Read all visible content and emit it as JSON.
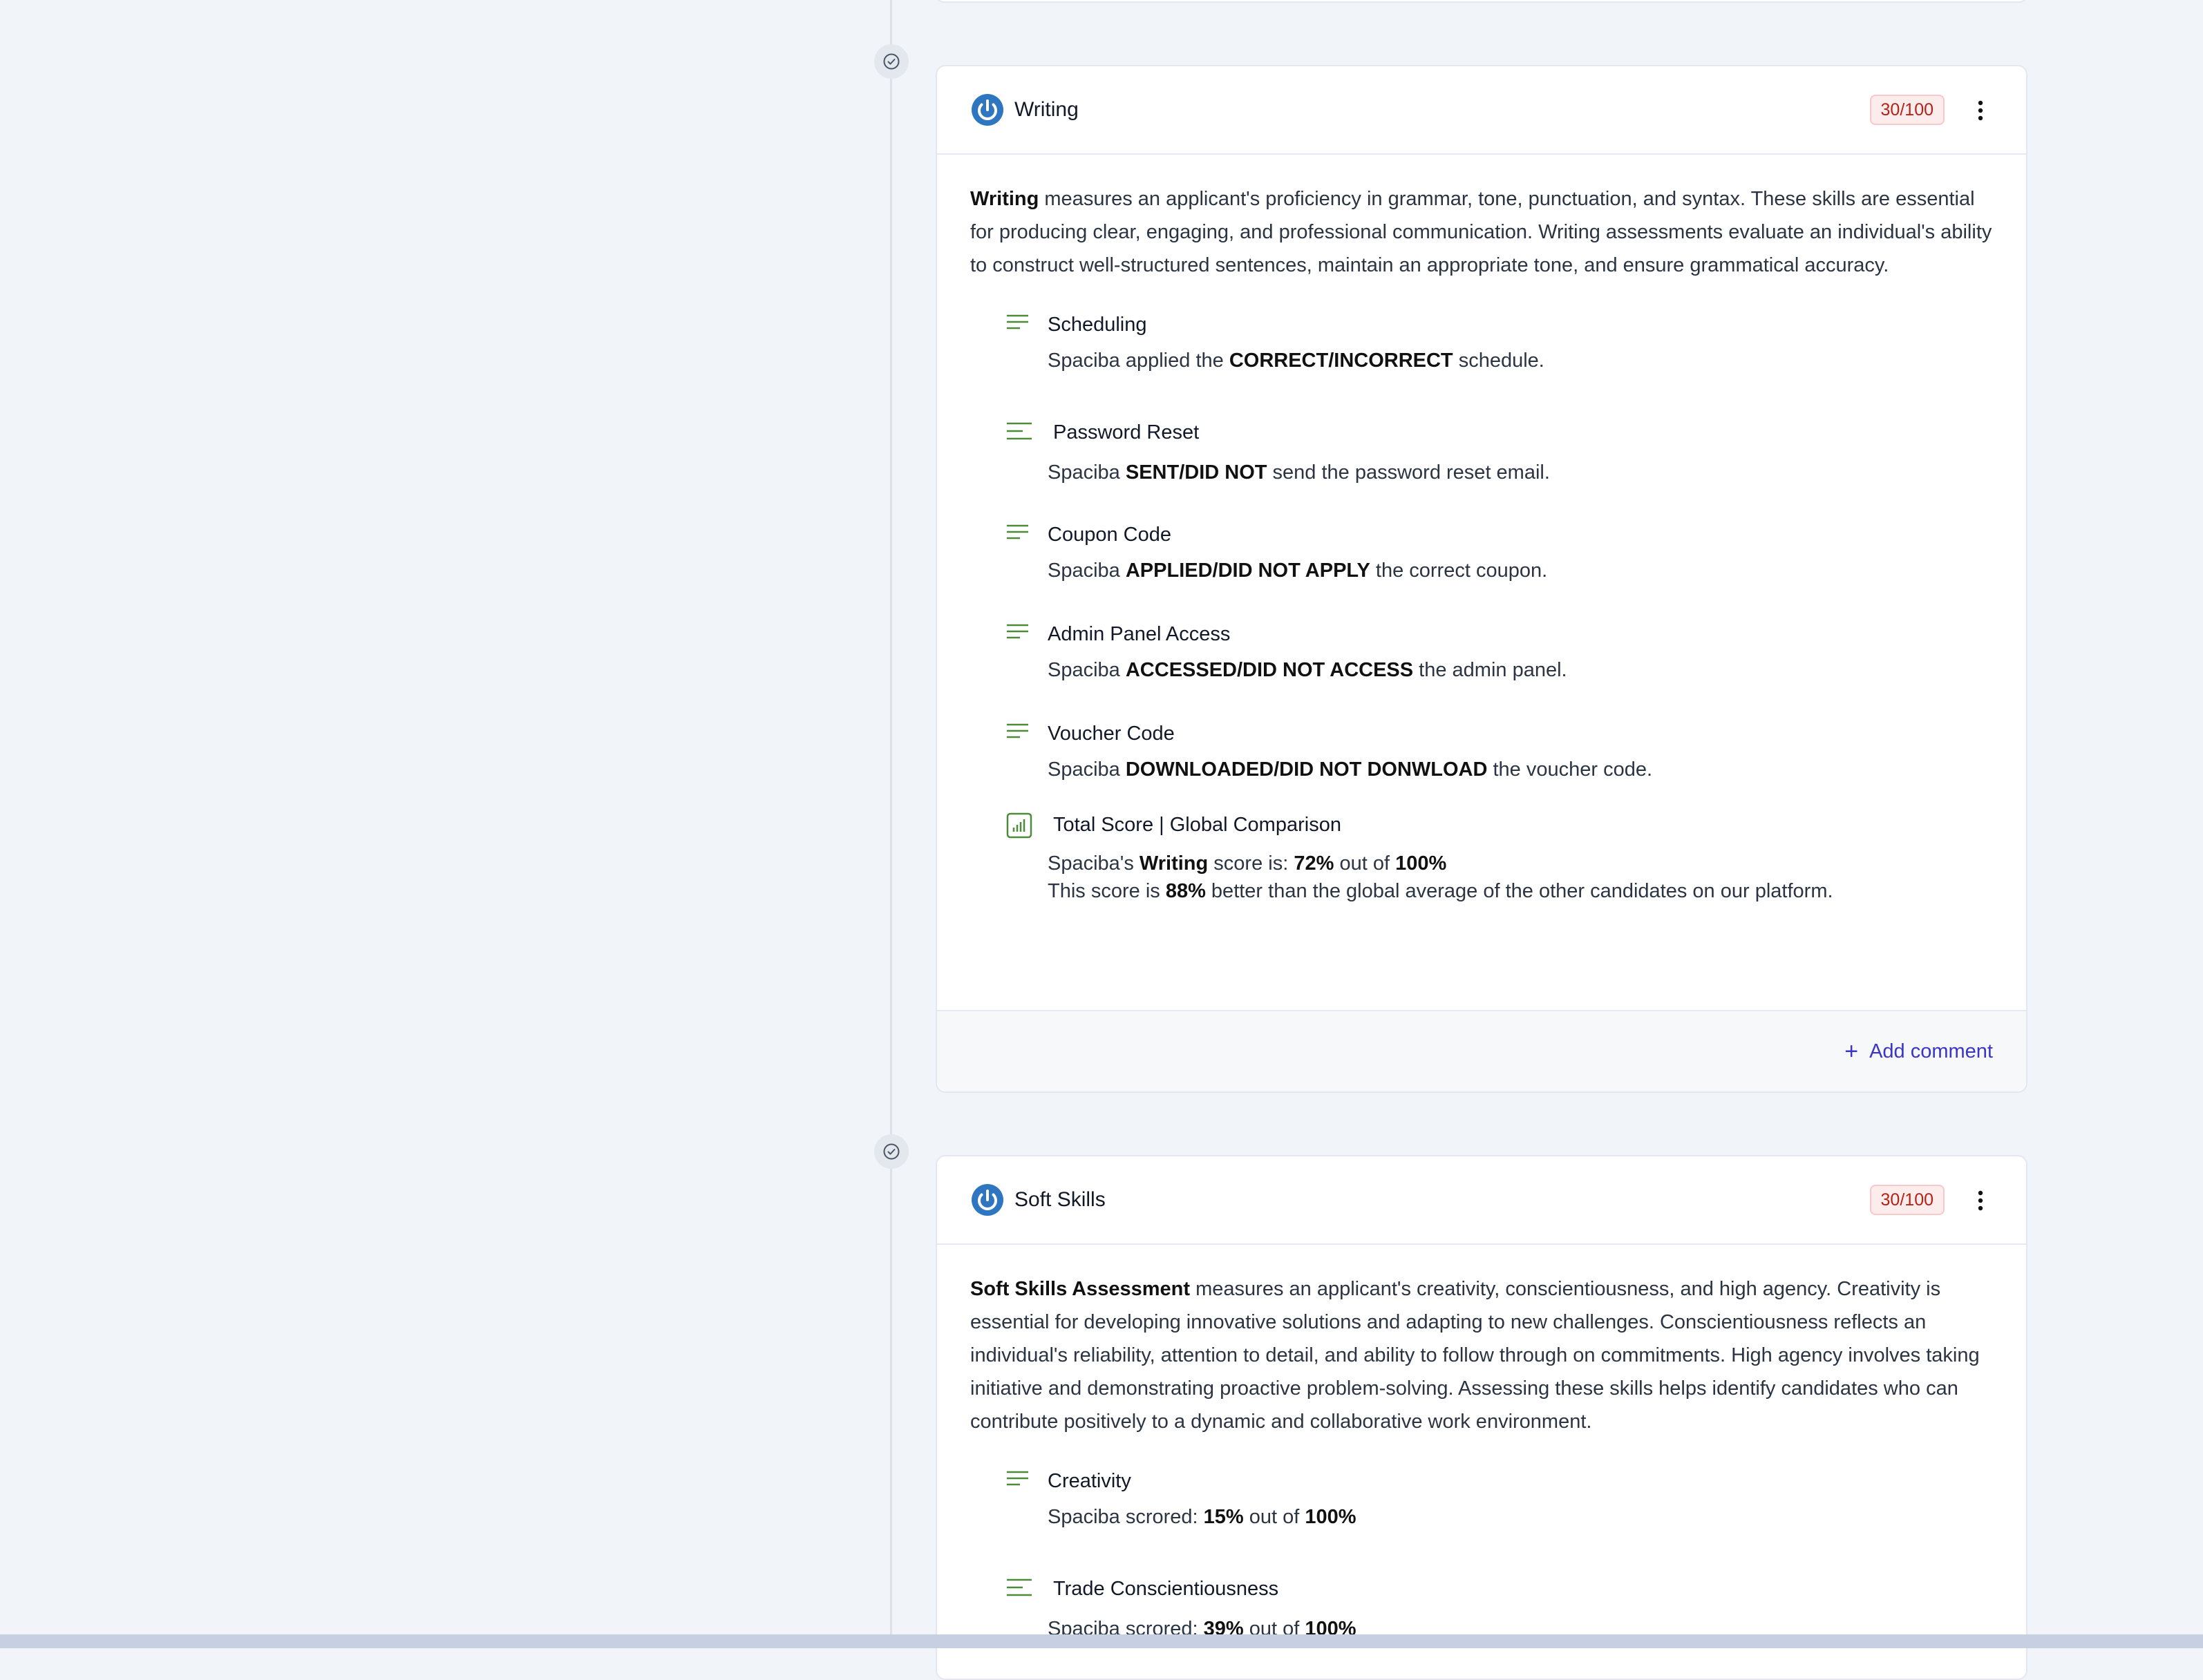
{
  "cards": [
    {
      "title": "Writing",
      "score": "30/100",
      "description_bold": "Writing",
      "description_rest": " measures an applicant's proficiency in grammar, tone, punctuation, and syntax. These skills are essential for producing clear, engaging, and professional communication. Writing assessments evaluate an individual's ability to construct well-structured sentences, maintain an appropriate tone, and ensure grammatical accuracy.",
      "items": [
        {
          "icon": "lines-icon",
          "title": "Scheduling",
          "pre": "Spaciba applied the ",
          "bold": "CORRECT/INCORRECT",
          "post": " schedule."
        },
        {
          "icon": "align-left-icon",
          "title": "Password Reset",
          "pre": "Spaciba ",
          "bold": "SENT/DID NOT",
          "post": " send the password reset email."
        },
        {
          "icon": "lines-icon",
          "title": "Coupon Code",
          "pre": "Spaciba ",
          "bold": "APPLIED/DID NOT APPLY",
          "post": " the correct coupon."
        },
        {
          "icon": "lines-icon",
          "title": "Admin Panel Access",
          "pre": "Spaciba ",
          "bold": "ACCESSED/DID NOT ACCESS",
          "post": " the admin panel."
        },
        {
          "icon": "lines-icon",
          "title": "Voucher Code",
          "pre": "Spaciba ",
          "bold": "DOWNLOADED/DID NOT DONWLOAD",
          "post": " the voucher code."
        }
      ],
      "total": {
        "title": "Total Score | Global Comparison",
        "l1_pre": "Spaciba's ",
        "l1_b1": "Writing",
        "l1_mid": " score is: ",
        "l1_b2": "72%",
        "l1_mid2": " out of ",
        "l1_b3": "100%",
        "l2_pre": "This score is ",
        "l2_b": "88%",
        "l2_post": " better than the global average of the other candidates on our platform."
      },
      "add_comment": "Add comment"
    },
    {
      "title": "Soft Skills",
      "score": "30/100",
      "description_bold": "Soft Skills Assessment",
      "description_rest": " measures an applicant's creativity, conscientiousness, and high agency. Creativity is essential for developing innovative solutions and adapting to new challenges. Conscientiousness reflects an individual's reliability, attention to detail, and ability to follow through on commitments. High agency involves taking initiative and demonstrating proactive problem-solving. Assessing these skills helps identify candidates who can contribute positively to a dynamic and collaborative work environment.",
      "items": [
        {
          "icon": "lines-icon",
          "title": "Creativity",
          "pre": "Spaciba scrored: ",
          "bold": "15%",
          "mid": " out of ",
          "bold2": "100%"
        },
        {
          "icon": "align-left-icon",
          "title": "Trade Conscientiousness",
          "pre": "Spaciba scrored: ",
          "bold": "39%",
          "mid": " out of ",
          "bold2": "100%"
        }
      ]
    }
  ]
}
